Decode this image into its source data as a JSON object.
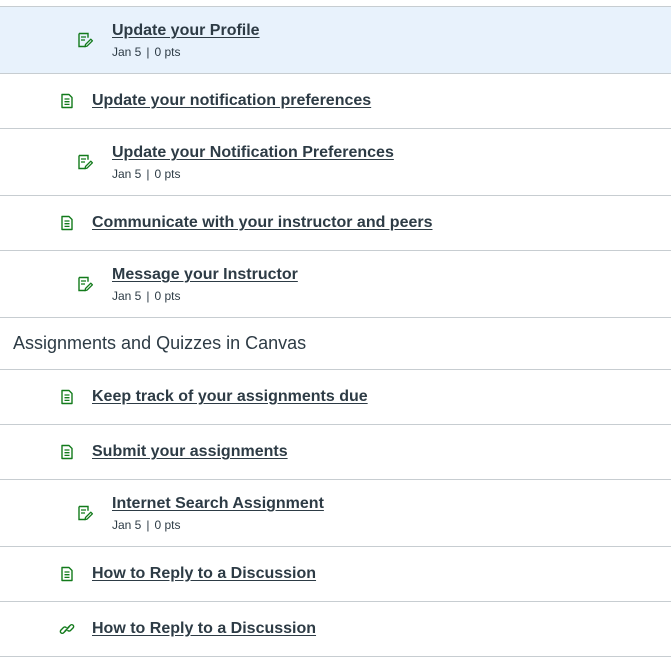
{
  "colors": {
    "text": "#2d3b45",
    "icon_green": "#127a1b",
    "selected_bg": "#e8f2fc",
    "divider": "#c7cdd1"
  },
  "items": [
    {
      "type": "assignment",
      "indent": 2,
      "title": "Update your Profile",
      "date": "Jan 5",
      "points": "0 pts",
      "selected": true,
      "icon": "assignment-icon"
    },
    {
      "type": "page",
      "indent": 1,
      "title": "Update your notification preferences",
      "icon": "page-icon"
    },
    {
      "type": "assignment",
      "indent": 2,
      "title": "Update your Notification Preferences",
      "date": "Jan 5",
      "points": "0 pts",
      "icon": "assignment-icon"
    },
    {
      "type": "page",
      "indent": 1,
      "title": "Communicate with your instructor and peers",
      "icon": "page-icon"
    },
    {
      "type": "assignment",
      "indent": 2,
      "title": "Message your Instructor",
      "date": "Jan 5",
      "points": "0 pts",
      "icon": "assignment-icon"
    }
  ],
  "module": {
    "title": "Assignments and Quizzes in Canvas",
    "items": [
      {
        "type": "page",
        "indent": 1,
        "title": "Keep track of your assignments due",
        "icon": "page-icon"
      },
      {
        "type": "page",
        "indent": 1,
        "title": "Submit your assignments",
        "icon": "page-icon"
      },
      {
        "type": "assignment",
        "indent": 2,
        "title": "Internet Search Assignment",
        "date": "Jan 5",
        "points": "0 pts",
        "icon": "assignment-icon"
      },
      {
        "type": "page",
        "indent": 1,
        "title": "How to Reply to a Discussion",
        "icon": "page-icon"
      },
      {
        "type": "link",
        "indent": 1,
        "title": "How to Reply to a Discussion",
        "icon": "external-link-icon"
      }
    ]
  },
  "separator": "|"
}
